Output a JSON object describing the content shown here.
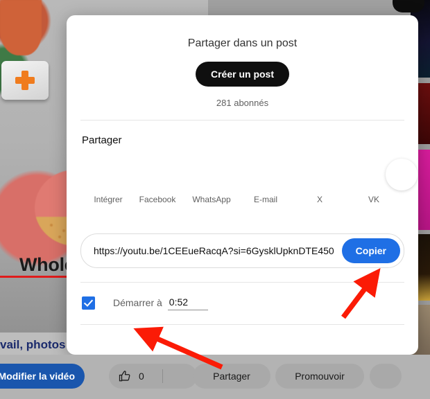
{
  "modal": {
    "title": "Partager dans un post",
    "create_post_label": "Créer un post",
    "subscribers": "281 abonnés",
    "share_section_label": "Partager",
    "share_targets": [
      {
        "label": "Intégrer",
        "icon": "embed-icon"
      },
      {
        "label": "Facebook",
        "icon": "facebook-icon"
      },
      {
        "label": "WhatsApp",
        "icon": "whatsapp-icon"
      },
      {
        "label": "E-mail",
        "icon": "email-icon"
      },
      {
        "label": "X",
        "icon": "x-icon"
      },
      {
        "label": "VK",
        "icon": "vk-icon"
      }
    ],
    "url_value": "https://youtu.be/1CEEueRacqA?si=6GysklUpknDTE450",
    "url_placeholder": "",
    "copy_label": "Copier",
    "start_at_label": "Démarrer à",
    "start_at_time": "0:52",
    "start_at_checked": true
  },
  "action_bar": {
    "edit_label": "Modifier la vidéo",
    "like_count": "0",
    "share_label": "Partager",
    "promote_label": "Promouvoir",
    "more_label": ""
  },
  "background": {
    "video_title_fragment": "Whole",
    "description_fragment": "vail, photos",
    "rail_thumbnails": [
      {
        "color": "#0b0b18"
      },
      {
        "color": "#5e0c0c"
      },
      {
        "color": "#cc1a93"
      },
      {
        "color": "#1a1008"
      },
      {
        "color": "#8d7b63"
      },
      {
        "color": "#e8c53a"
      }
    ]
  },
  "annotations": {
    "arrow_color": "#fb1b06",
    "arrow_targets": [
      "copier-button",
      "demarrer-a-checkbox"
    ]
  }
}
